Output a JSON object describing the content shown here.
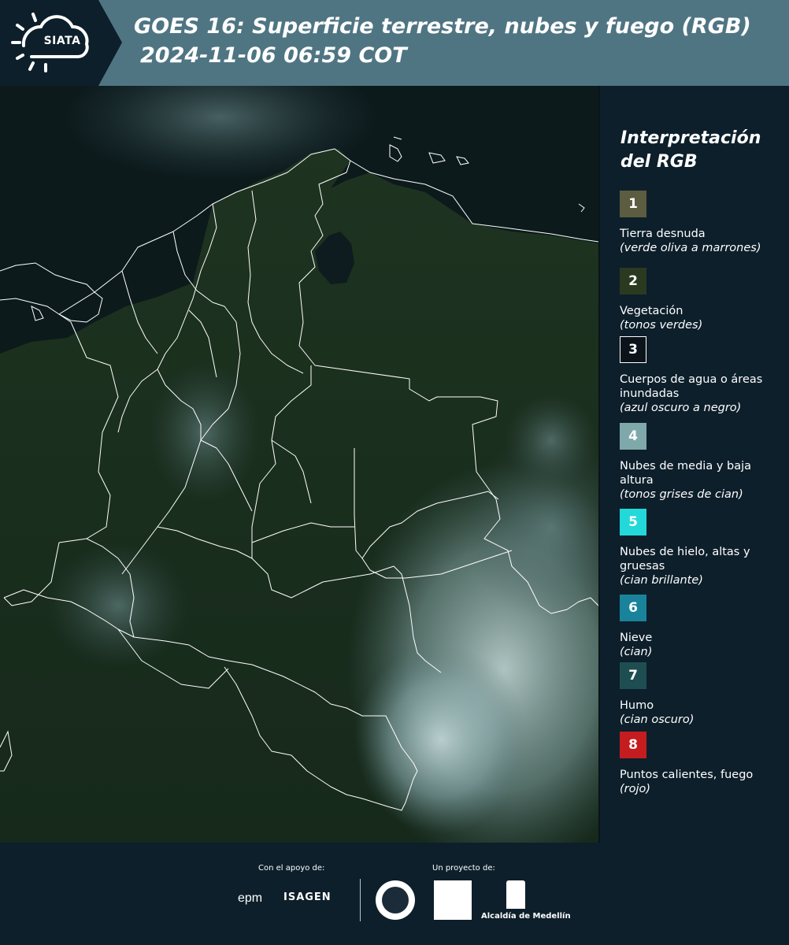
{
  "header": {
    "logo_text": "SIATA",
    "title_line1": "GOES 16: Superficie terrestre, nubes y fuego (RGB)",
    "title_line2": "2024-11-06 06:59 COT"
  },
  "colors": {
    "header_bg": "#4f7583",
    "page_bg": "#0d1f2b",
    "logo_panel_bg": "#0d1f2b",
    "border_lines": "#ffffff"
  },
  "legend": {
    "title": "Interpretación del RGB",
    "items": [
      {
        "number": "1",
        "label": "Tierra desnuda",
        "note": "(verde oliva a marrones)",
        "color": "#5b5c40"
      },
      {
        "number": "2",
        "label": "Vegetación",
        "note": "(tonos verdes)",
        "color": "#2a3a20"
      },
      {
        "number": "3",
        "label": "Cuerpos de agua o áreas inundadas",
        "note": "(azul oscuro a negro)",
        "color": "#0a141a"
      },
      {
        "number": "4",
        "label": "Nubes de media y baja altura",
        "note": "(tonos grises de cian)",
        "color": "#7fa8aa"
      },
      {
        "number": "5",
        "label": "Nubes de hielo, altas y gruesas",
        "note": "(cian brillante)",
        "color": "#23d8d8"
      },
      {
        "number": "6",
        "label": "Nieve",
        "note": "(cian)",
        "color": "#19839b"
      },
      {
        "number": "7",
        "label": "Humo",
        "note": "(cian oscuro)",
        "color": "#1e4e52"
      },
      {
        "number": "8",
        "label": "Puntos calientes, fuego",
        "note": "(rojo)",
        "color": "#c51c1f"
      }
    ]
  },
  "footer": {
    "support_label": "Con el apoyo de:",
    "project_label": "Un proyecto de:",
    "epm": "epm",
    "isagen": "ISAGEN",
    "alcaldia": "Alcaldía de Medellín"
  }
}
